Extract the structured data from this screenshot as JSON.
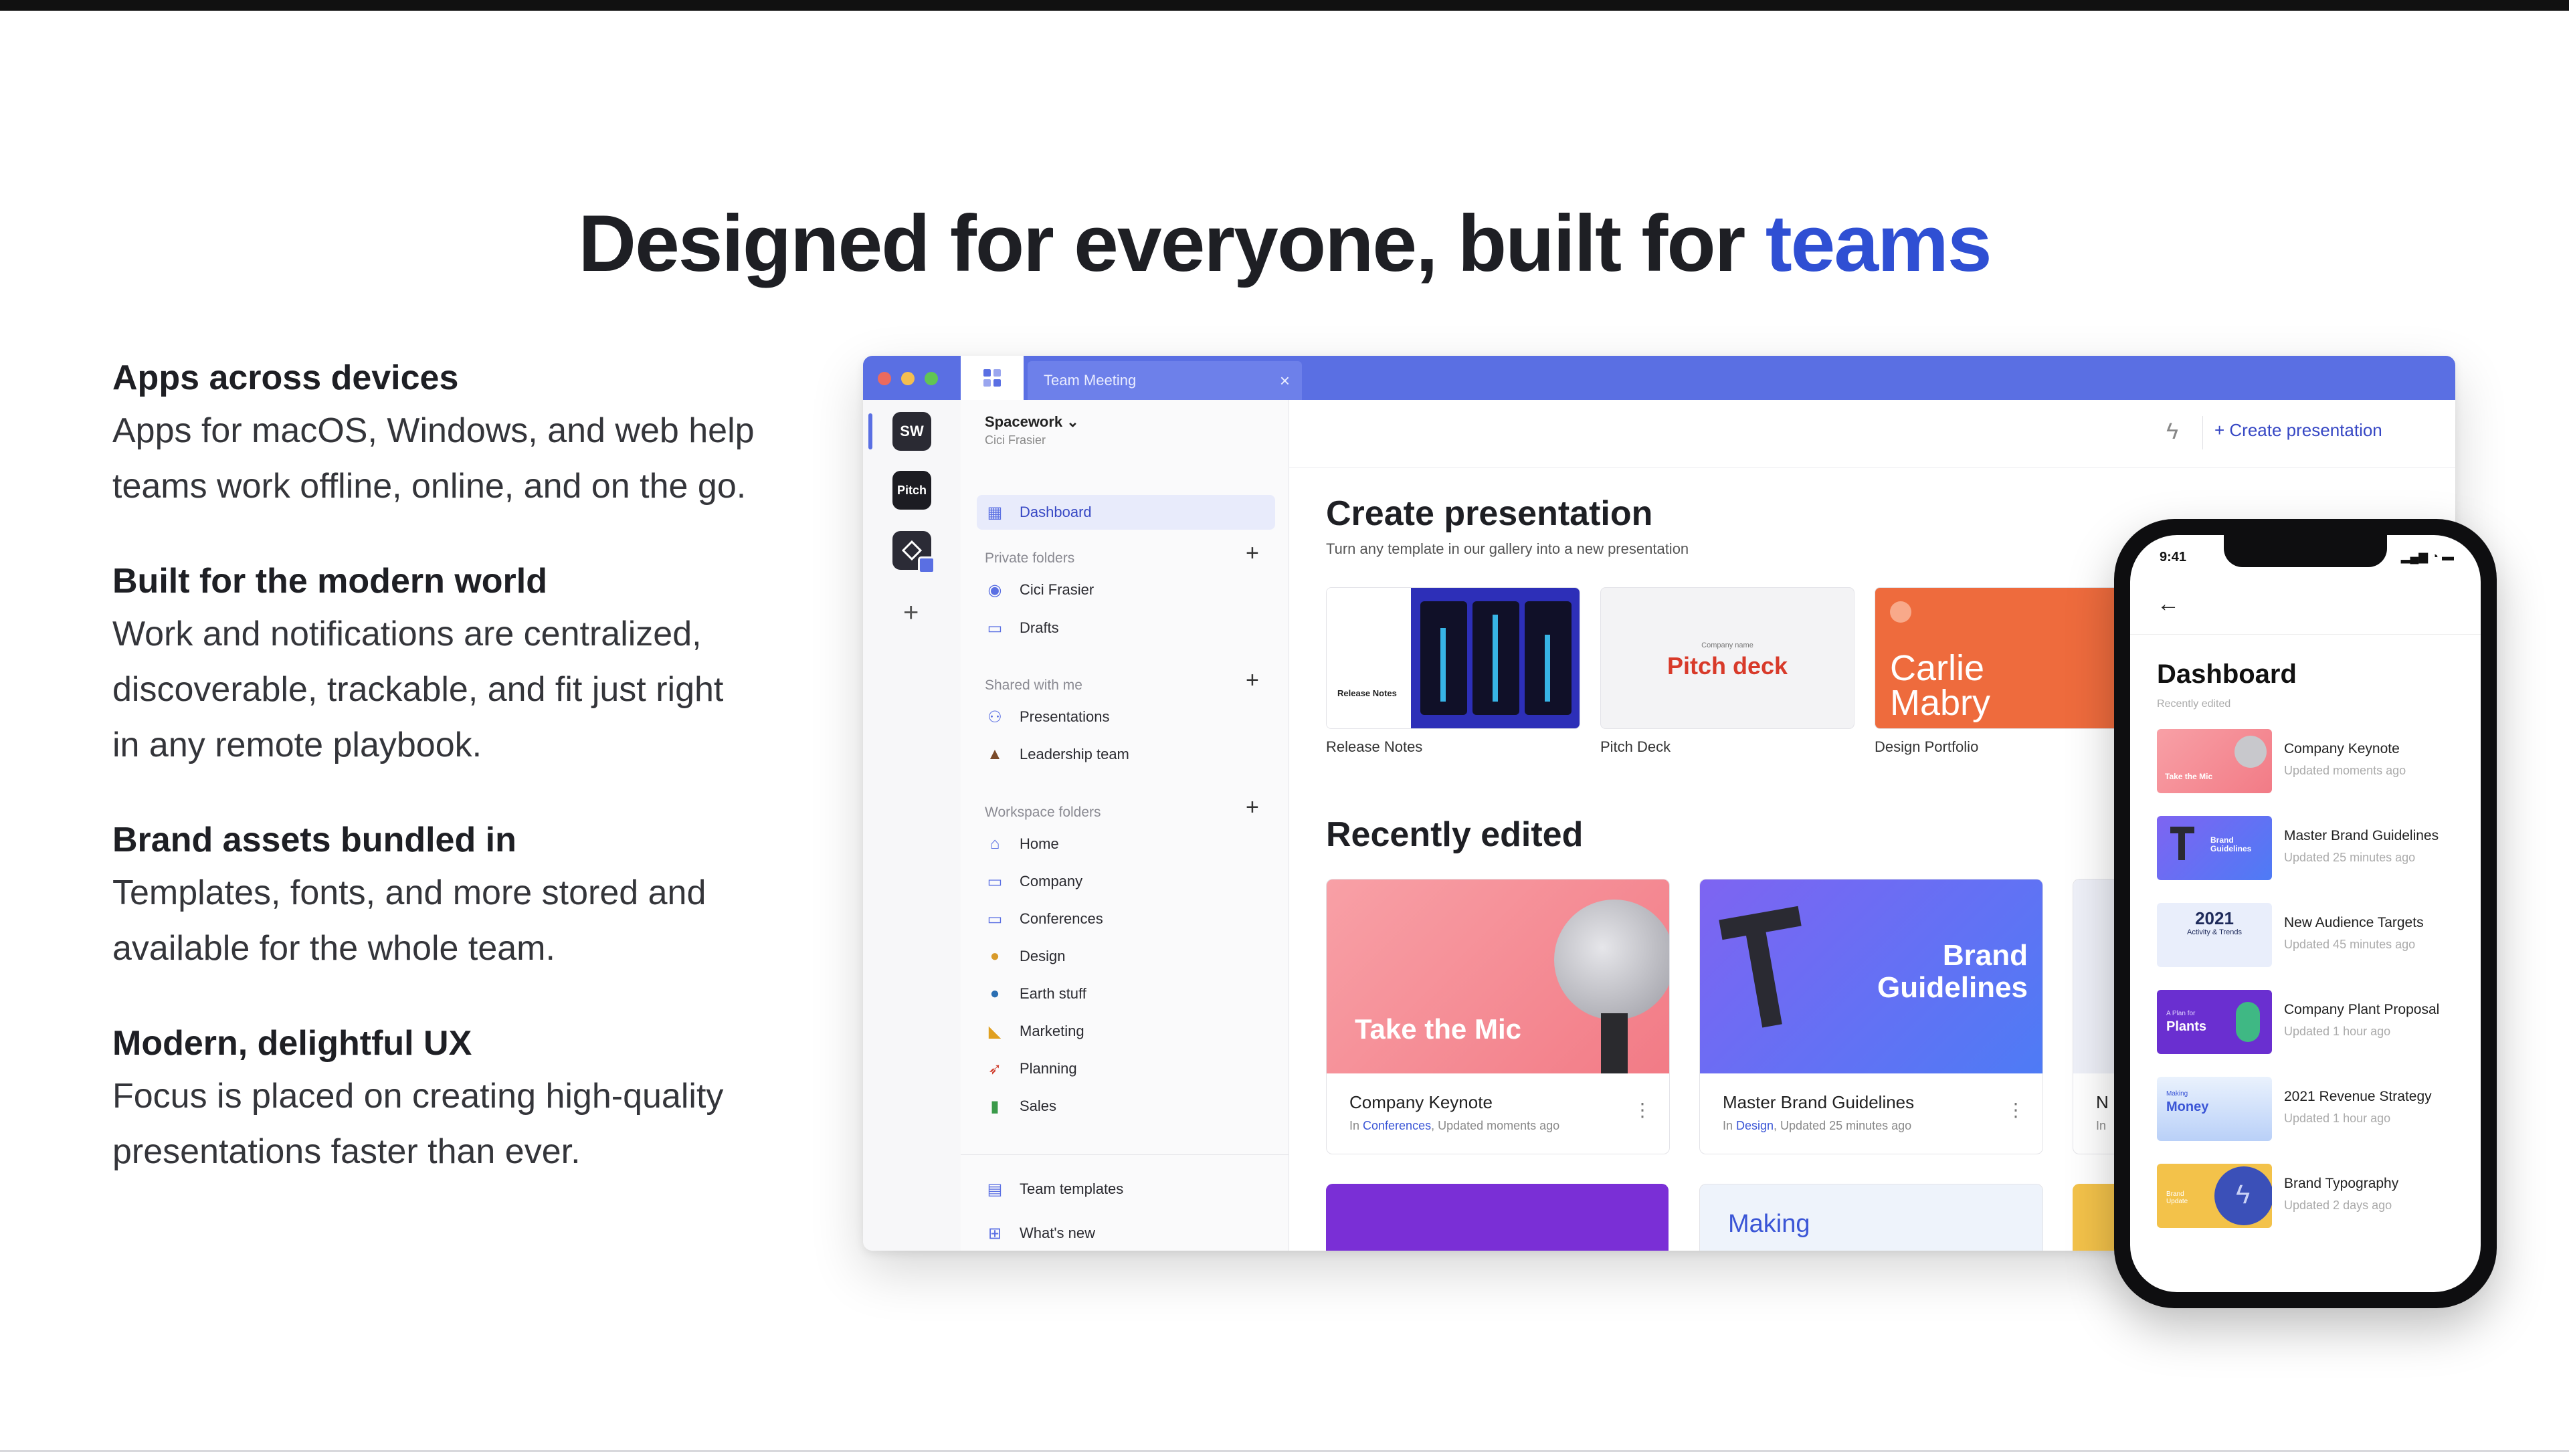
{
  "headline": {
    "prefix": "Designed for everyone, built for ",
    "accent": "teams"
  },
  "features": [
    {
      "title": "Apps across devices",
      "body": "Apps for macOS, Windows, and web help teams work offline, online, and on the go."
    },
    {
      "title": "Built for the modern world",
      "body": "Work and notifications are centralized, discoverable, trackable, and fit just right in any remote playbook."
    },
    {
      "title": "Brand assets bundled in",
      "body": "Templates, fonts, and more stored and available for the whole team."
    },
    {
      "title": "Modern, delightful UX",
      "body": "Focus is placed on creating high-quality presentations faster than ever."
    }
  ],
  "app": {
    "tab_title": "Team Meeting",
    "rail": {
      "ws1": "SW",
      "ws2": "Pitch"
    },
    "workspace": {
      "name": "Spacework",
      "user": "Cici Frasier"
    },
    "nav": {
      "dashboard": "Dashboard",
      "private_header": "Private folders",
      "private": [
        "Cici Frasier",
        "Drafts"
      ],
      "shared_header": "Shared with me",
      "shared": [
        "Presentations",
        "Leadership team"
      ],
      "workspace_header": "Workspace folders",
      "workspace": [
        "Home",
        "Company",
        "Conferences",
        "Design",
        "Earth stuff",
        "Marketing",
        "Planning",
        "Sales"
      ],
      "bottom": [
        "Team templates",
        "What's new"
      ]
    },
    "header": {
      "create_button": "+ Create presentation"
    },
    "create": {
      "title": "Create presentation",
      "subtitle": "Turn any template in our gallery into a new presentation",
      "templates": [
        {
          "label": "Release Notes",
          "thumb_text": "Release Notes"
        },
        {
          "label": "Pitch Deck",
          "thumb_text": "Pitch deck",
          "thumb_kicker": "Company name"
        },
        {
          "label": "Design Portfolio",
          "thumb_text": "Carlie Mabry"
        }
      ]
    },
    "recent": {
      "title": "Recently edited",
      "cards": [
        {
          "thumb_text": "Take the Mic",
          "title": "Company Keynote",
          "meta_prefix": "In ",
          "folder": "Conferences",
          "meta_suffix": ", Updated moments ago"
        },
        {
          "thumb_text": "Brand Guidelines",
          "title": "Master Brand Guidelines",
          "meta_prefix": "In ",
          "folder": "Design",
          "meta_suffix": ", Updated 25 minutes ago"
        }
      ],
      "peek_title": "N",
      "peek_meta": "In",
      "below_card": "Making"
    }
  },
  "phone": {
    "time": "9:41",
    "title": "Dashboard",
    "subtitle": "Recently edited",
    "items": [
      {
        "title": "Company Keynote",
        "meta": "Updated moments ago",
        "thumb": "Take the Mic"
      },
      {
        "title": "Master Brand Guidelines",
        "meta": "Updated 25 minutes ago",
        "thumb": "Brand Guidelines"
      },
      {
        "title": "New Audience Targets",
        "meta": "Updated 45 minutes ago",
        "thumb": "2021",
        "thumb_sub": "Activity & Trends"
      },
      {
        "title": "Company Plant Proposal",
        "meta": "Updated 1 hour ago",
        "thumb": "Plants",
        "thumb_kicker": "A Plan for"
      },
      {
        "title": "2021 Revenue Strategy",
        "meta": "Updated 1 hour ago",
        "thumb": "Money",
        "thumb_kicker": "Making"
      },
      {
        "title": "Brand Typography",
        "meta": "Updated 2 days ago",
        "thumb": "Brand Update"
      }
    ]
  },
  "colors": {
    "accent": "#2f4fd3",
    "titlebar": "#5a6fe3",
    "text": "#1e1f24"
  }
}
